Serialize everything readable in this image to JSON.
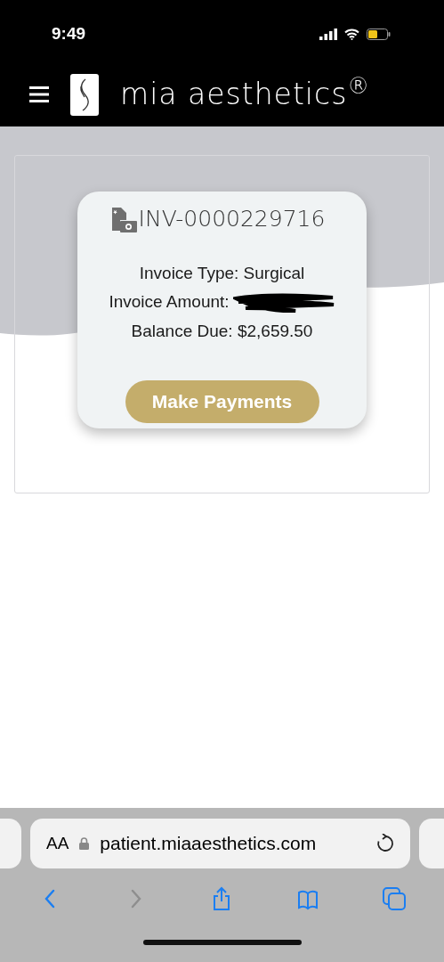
{
  "status_bar": {
    "time": "9:49"
  },
  "header": {
    "brand": "mia aesthetics$^{®}$"
  },
  "invoice": {
    "number": "INV-0000229716",
    "lines": [
      {
        "kind": "plain",
        "text": "Invoice Type: Surgical"
      },
      {
        "kind": "redacted",
        "text": "Invoice Amount:"
      },
      {
        "kind": "plain",
        "text": "Balance Due: $2,659.50"
      }
    ],
    "button": "Make Payments"
  },
  "browser": {
    "text_size": "AA",
    "url": "patient.miaaesthetics.com",
    "toolbar": [
      {
        "kind": "back",
        "disabled": false
      },
      {
        "kind": "forward",
        "disabled": true
      },
      {
        "kind": "share",
        "disabled": false
      },
      {
        "kind": "bookmarks",
        "disabled": false
      },
      {
        "kind": "tabs",
        "disabled": false
      }
    ]
  }
}
